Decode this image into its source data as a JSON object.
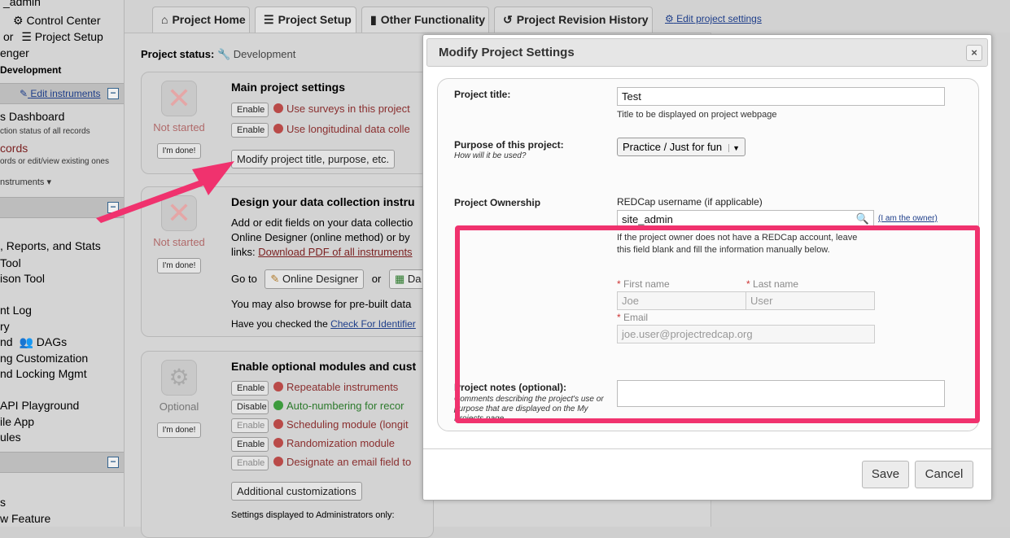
{
  "sidebar": {
    "user": "_admin",
    "control_center": "Control Center",
    "or": "or",
    "project_setup": "Project Setup",
    "enger": "enger",
    "status": "Development",
    "edit_instruments": "Edit instruments",
    "dashboard": "s Dashboard",
    "dashboard_sub": "ction status of all records",
    "records": "cords",
    "records_sub": "ords or edit/view existing ones",
    "instruments": "nstruments",
    "items": [
      ", Reports, and Stats",
      "Tool",
      "ison Tool",
      "nt Log",
      "ry",
      "nd",
      "DAGs",
      "ng Customization",
      "nd Locking Mgmt",
      "API Playground",
      "ile App",
      "ules",
      "s",
      "w Feature"
    ]
  },
  "tabs": [
    {
      "label": "Project Home",
      "icon": "home-icon"
    },
    {
      "label": "Project Setup",
      "icon": "list-icon"
    },
    {
      "label": "Other Functionality",
      "icon": "book-icon"
    },
    {
      "label": "Project Revision History",
      "icon": "history-icon"
    }
  ],
  "edit_project_settings": "Edit project settings",
  "project_status": {
    "label": "Project status:",
    "value": "Development"
  },
  "cards": {
    "main": {
      "title": "Main project settings",
      "status": "Not started",
      "done": "I'm done!",
      "rows": [
        {
          "button": "Enable",
          "text": "Use surveys in this project"
        },
        {
          "button": "Enable",
          "text": "Use longitudinal data colle"
        }
      ],
      "modify_button": "Modify project title, purpose, etc."
    },
    "design": {
      "title": "Design your data collection instru",
      "status": "Not started",
      "done": "I'm done!",
      "line1": "Add or edit fields on your data collectio",
      "line2": "Online Designer (online method) or by",
      "line3_prefix": "links:",
      "line3_link": "Download PDF of all instruments",
      "goto": "Go to",
      "online_designer": "Online Designer",
      "or": "or",
      "da": "Da",
      "browse": "You may also browse for pre-built data",
      "checked_prefix": "Have you checked the",
      "checked_link": "Check For Identifier"
    },
    "optional": {
      "title": "Enable optional modules and cust",
      "status": "Optional",
      "done": "I'm done!",
      "rows": [
        {
          "button": "Enable",
          "text": "Repeatable instruments",
          "state": "off"
        },
        {
          "button": "Disable",
          "text": "Auto-numbering for recor",
          "state": "on"
        },
        {
          "button": "Enable",
          "text": "Scheduling module (longit",
          "state": "off"
        },
        {
          "button": "Enable",
          "text": "Randomization module",
          "state": "off"
        },
        {
          "button": "Enable",
          "text": "Designate an email field to",
          "state": "off"
        }
      ],
      "additional": "Additional customizations",
      "admin_note": "Settings displayed to Administrators only:"
    }
  },
  "dialog": {
    "title": "Modify Project Settings",
    "close": "×",
    "project_title_label": "Project title:",
    "project_title_value": "Test",
    "project_title_hint": "Title to be displayed on project webpage",
    "purpose_label": "Purpose of this project:",
    "purpose_sub": "How will it be used?",
    "purpose_value": "Practice / Just for fun",
    "ownership_label": "Project Ownership",
    "username_label": "REDCap username (if applicable)",
    "username_value": "site_admin",
    "i_am_owner": "(I am the owner)",
    "owner_hint": "If the project owner does not have a REDCap account, leave this field blank and fill the information manually below.",
    "first_name_label": "First name",
    "first_name_value": "Joe",
    "last_name_label": "Last name",
    "last_name_value": "User",
    "email_label": "Email",
    "email_value": "joe.user@projectredcap.org",
    "notes_label": "Project notes (optional):",
    "notes_sub": "Comments describing the project's use or purpose that are displayed on the My Projects page.",
    "save": "Save",
    "cancel": "Cancel"
  },
  "colors": {
    "highlight": "#f0326e",
    "arrow": "#f0326e",
    "link": "#1e3e8a"
  }
}
